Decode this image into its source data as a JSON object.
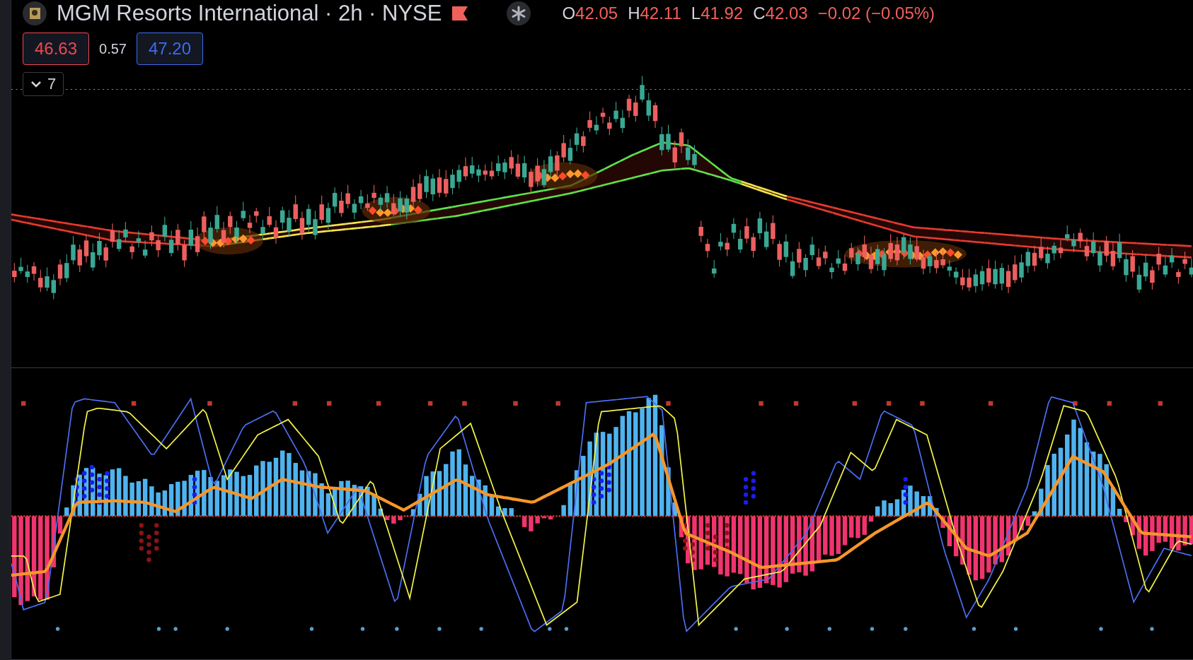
{
  "legend": {
    "title": "MGM Resorts International · 2h · NYSE",
    "ohlc": [
      {
        "label": "O",
        "value": "42.05"
      },
      {
        "label": "H",
        "value": "42.11"
      },
      {
        "label": "L",
        "value": "41.92"
      },
      {
        "label": "C",
        "value": "42.03"
      }
    ],
    "change": "−0.02 (−0.05%)"
  },
  "trade": {
    "sell_price": "46.63",
    "spread": "0.57",
    "buy_price": "47.20"
  },
  "indicators_toggle": {
    "count": "7"
  }
}
